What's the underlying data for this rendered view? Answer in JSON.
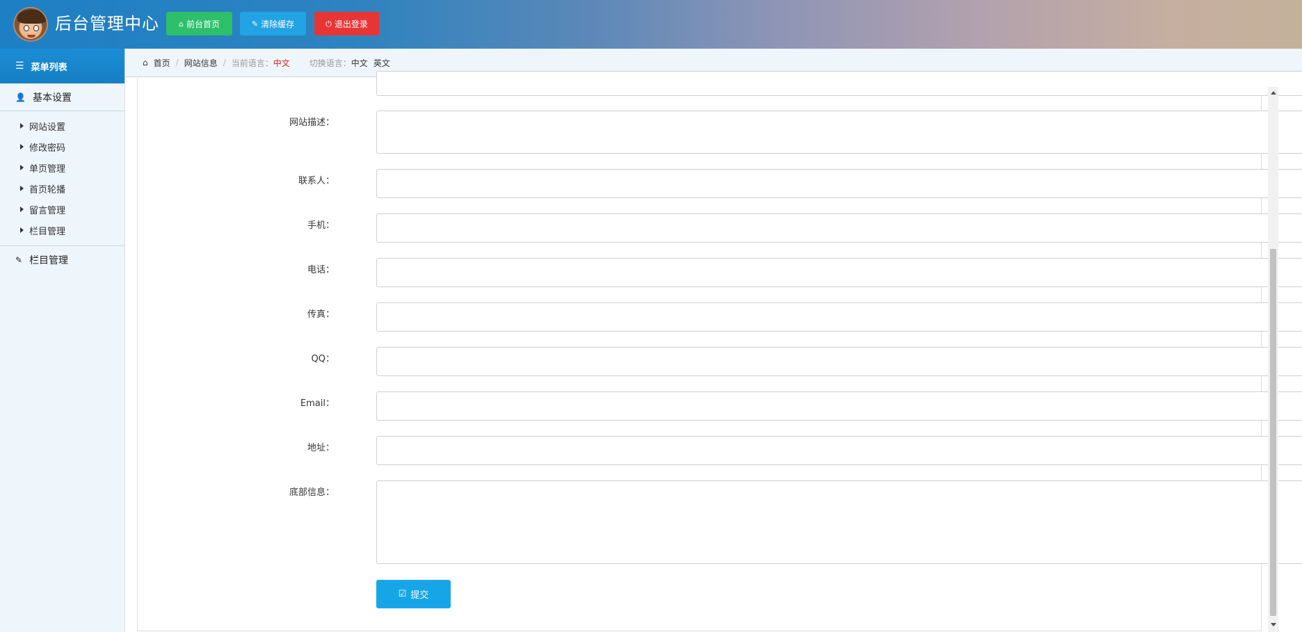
{
  "header": {
    "title": "后台管理中心",
    "buttons": {
      "home": {
        "icon": "home-icon",
        "label": "前台首页",
        "color": "#2dbf6a"
      },
      "cache": {
        "icon": "wrench-icon",
        "label": "清除缓存",
        "color": "#22a3e3"
      },
      "logout": {
        "icon": "power-icon",
        "label": "退出登录",
        "color": "#e73535"
      }
    }
  },
  "sidebar": {
    "menu_title": "菜单列表",
    "group1": {
      "title": "基本设置",
      "items": [
        "网站设置",
        "修改密码",
        "单页管理",
        "首页轮播",
        "留言管理",
        "栏目管理"
      ]
    },
    "group2": {
      "title": "栏目管理"
    }
  },
  "breadcrumb": {
    "home": "首页",
    "current": "网站信息",
    "lang_label": "当前语言：",
    "lang_value": "中文",
    "switch_label": "切换语言：",
    "switch_options": [
      "中文",
      "英文"
    ]
  },
  "form": {
    "labels": {
      "description": "网站描述：",
      "contact": "联系人：",
      "mobile": "手机：",
      "phone": "电话：",
      "fax": "传真：",
      "qq": "QQ：",
      "email": "Email：",
      "address": "地址：",
      "footer": "底部信息："
    },
    "values": {
      "description": "",
      "contact": "",
      "mobile": "",
      "phone": "",
      "fax": "",
      "qq": "",
      "email": "",
      "address": "",
      "footer": ""
    },
    "submit_label": "提交"
  },
  "colors": {
    "accent": "#16a6e8",
    "sidebar_bg": "#eef6fc",
    "breadcrumb_red": "#d22222"
  }
}
